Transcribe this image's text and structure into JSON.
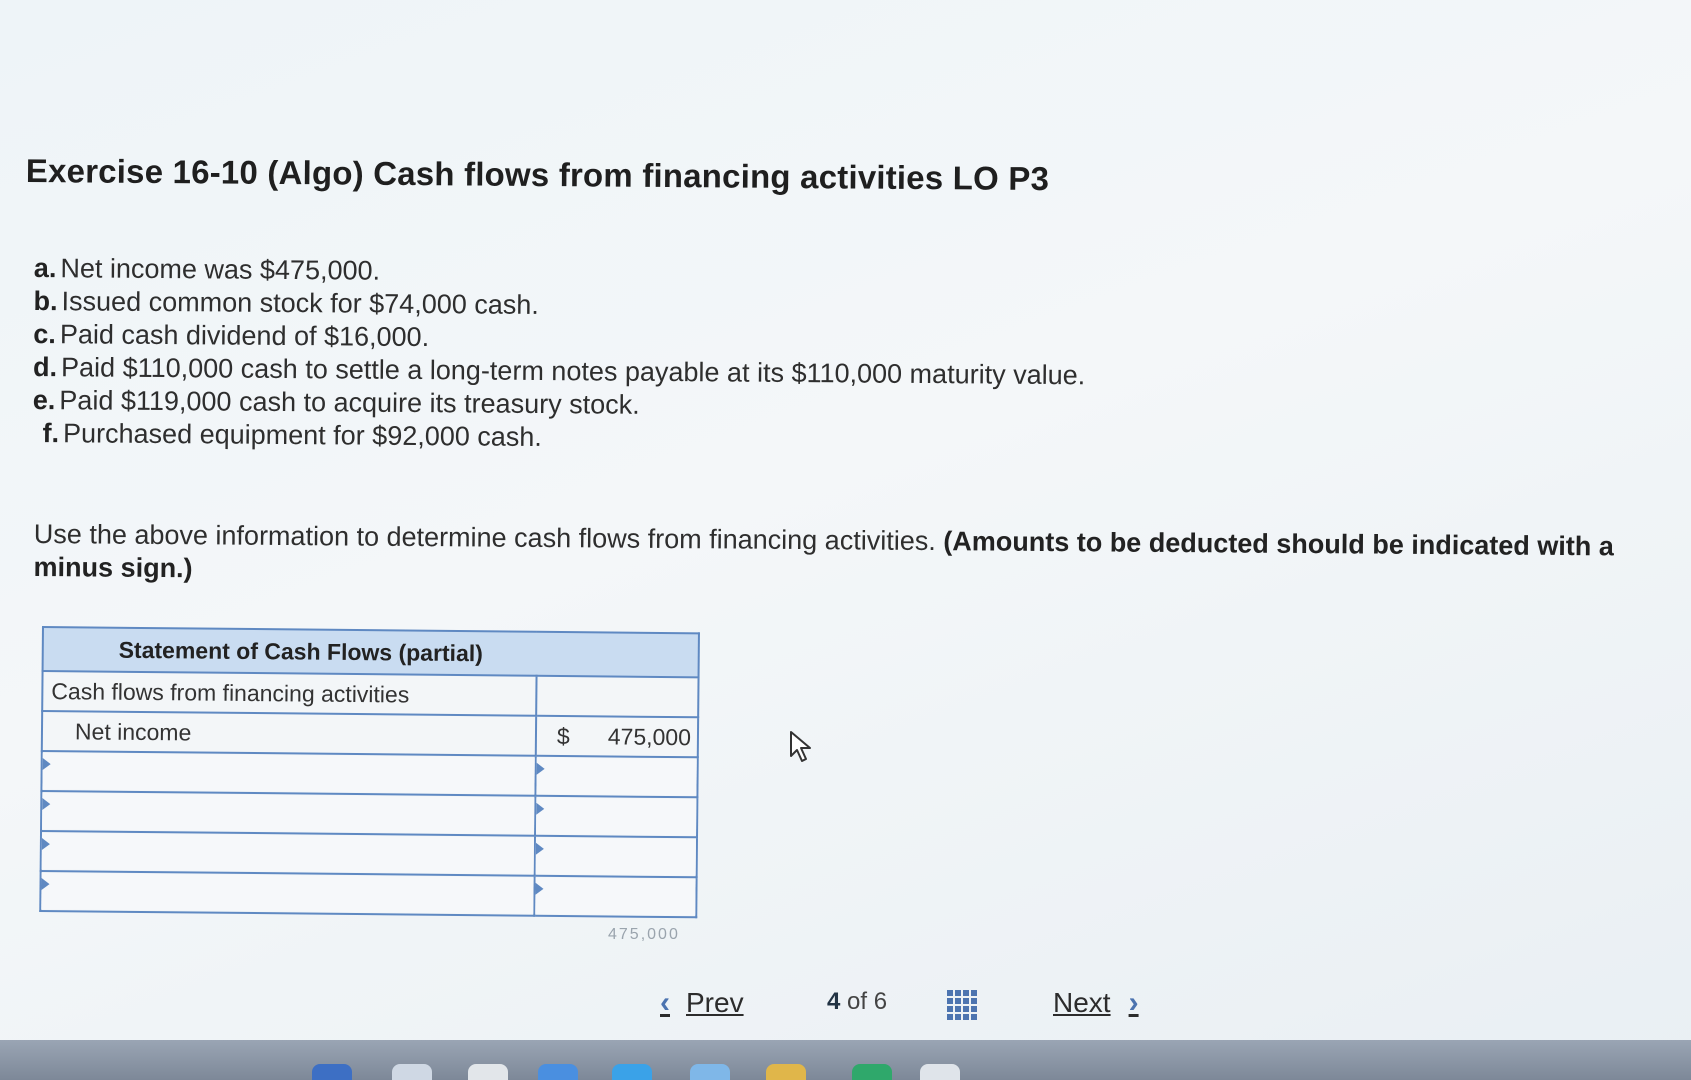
{
  "exercise_title": "Exercise 16-10 (Algo) Cash flows from financing activities LO P3",
  "facts": [
    {
      "letter": "a.",
      "text": "Net income was $475,000."
    },
    {
      "letter": "b.",
      "text": "Issued common stock for $74,000 cash."
    },
    {
      "letter": "c.",
      "text": "Paid cash dividend of $16,000."
    },
    {
      "letter": "d.",
      "text": "Paid $110,000 cash to settle a long-term notes payable at its $110,000 maturity value."
    },
    {
      "letter": "e.",
      "text": "Paid $119,000 cash to acquire its treasury stock."
    },
    {
      "letter": "f.",
      "text": "Purchased equipment for $92,000 cash."
    }
  ],
  "instruction": {
    "text": "Use the above information to determine cash flows from financing activities.",
    "note": "(Amounts to be deducted should be indicated with a minus sign.)"
  },
  "statement": {
    "header": "Statement of Cash Flows (partial)",
    "section_label": "Cash flows from financing activities",
    "first_row": {
      "label": "Net income",
      "currency": "$",
      "amount": "475,000"
    },
    "input_rows": [
      {
        "label": "",
        "amount": ""
      },
      {
        "label": "",
        "amount": ""
      },
      {
        "label": "",
        "amount": ""
      },
      {
        "label": "",
        "amount": ""
      }
    ],
    "cut_total": "475,000"
  },
  "navigation": {
    "prev_label": "Prev",
    "current_page": "4",
    "of_label": "of",
    "total_pages": "6",
    "next_label": "Next"
  },
  "icons": {
    "cursor": "mouse-pointer-icon",
    "prev_chevron": "chevron-left-icon",
    "next_chevron": "chevron-right-icon",
    "question_grid": "grid-icon"
  },
  "colors": {
    "table_border": "#5f89c2",
    "table_header_bg": "#c9dcf1",
    "nav_accent": "#4c74b0"
  }
}
